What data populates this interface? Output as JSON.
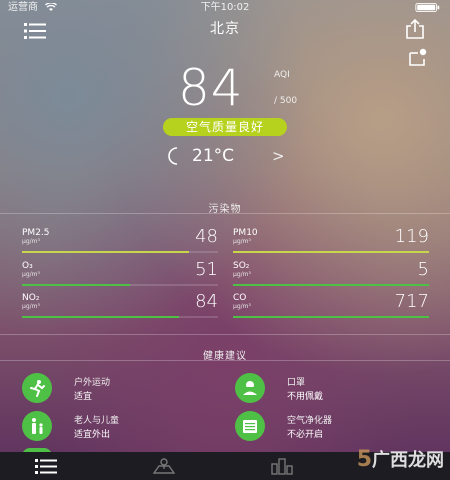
{
  "status_bar": {
    "carrier": "运营商",
    "time": "下午10:02"
  },
  "header": {
    "city": "北京"
  },
  "aqi": {
    "value": "84",
    "label": "AQI",
    "max": "/ 500",
    "quality": "空气质量良好",
    "quality_color": "#b7d21e"
  },
  "weather": {
    "temperature": "21°C",
    "arrow": ">"
  },
  "pollutants_section": {
    "title": "污染物",
    "items": [
      {
        "name": "PM2.5",
        "unit": "μg/m³",
        "value": "48",
        "level": 0.85,
        "color": "#c7d64b"
      },
      {
        "name": "PM10",
        "unit": "μg/m³",
        "value": "119",
        "level": 1.0,
        "color": "#c7d64b"
      },
      {
        "name": "O₃",
        "unit": "μg/m³",
        "value": "51",
        "level": 0.55,
        "color": "#4fc046"
      },
      {
        "name": "SO₂",
        "unit": "μg/m³",
        "value": "5",
        "level": 1.0,
        "color": "#4fc046"
      },
      {
        "name": "NO₂",
        "unit": "μg/m³",
        "value": "84",
        "level": 0.8,
        "color": "#4fc046"
      },
      {
        "name": "CO",
        "unit": "μg/m³",
        "value": "717",
        "level": 1.0,
        "color": "#4fc046"
      }
    ]
  },
  "advice_section": {
    "title": "健康建议",
    "items": [
      {
        "title": "户外运动",
        "desc": "适宜",
        "icon": "running-person-icon"
      },
      {
        "title": "口罩",
        "desc": "不用佩戴",
        "icon": "mask-icon"
      },
      {
        "title": "老人与儿童",
        "desc": "适宜外出",
        "icon": "family-icon"
      },
      {
        "title": "空气净化器",
        "desc": "不必开启",
        "icon": "air-purifier-icon"
      }
    ]
  },
  "watermark": {
    "number": "5",
    "text": "广西龙网"
  }
}
